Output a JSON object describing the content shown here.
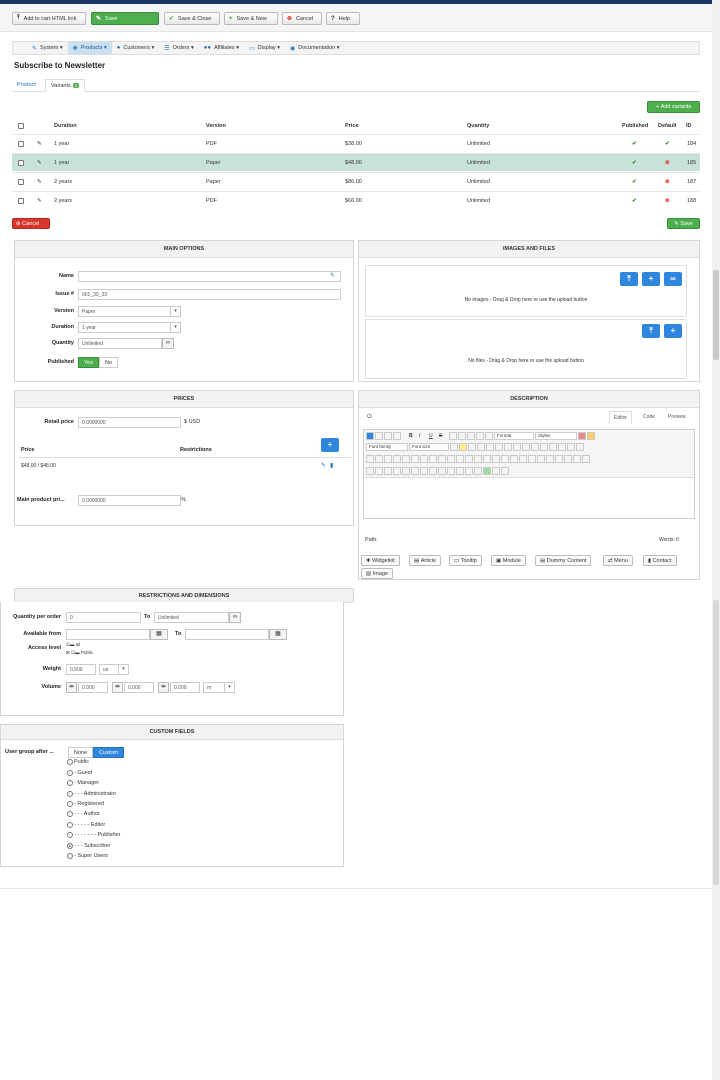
{
  "toolbar": {
    "add_to_cart": "Add to cart HTML link",
    "save": "Save",
    "save_close": "Save & Close",
    "save_new": "Save & New",
    "cancel": "Cancel",
    "help": "Help"
  },
  "menu": {
    "items": [
      "System",
      "Products",
      "Customers",
      "Orders",
      "Affiliates",
      "Display",
      "Documentation"
    ],
    "active": "Products"
  },
  "page_title": "Subscribe to Newsletter",
  "tabs": {
    "product": "Product",
    "variants": "Variants",
    "variants_count": "4"
  },
  "variants": {
    "add_button": "Add variants",
    "headers": {
      "duration": "Duration",
      "version": "Version",
      "price": "Price",
      "quantity": "Quantity",
      "published": "Published",
      "default": "Default",
      "id": "ID"
    },
    "rows": [
      {
        "duration": "1 year",
        "version": "PDF",
        "price": "$38.00",
        "quantity": "Unlimited",
        "published": "yes",
        "default": "yes",
        "id": "184"
      },
      {
        "duration": "1 year",
        "version": "Paper",
        "price": "$48.00",
        "quantity": "Unlimited",
        "published": "yes",
        "default": "no",
        "id": "185"
      },
      {
        "duration": "2 years",
        "version": "Paper",
        "price": "$86.00",
        "quantity": "Unlimited",
        "published": "yes",
        "default": "no",
        "id": "187"
      },
      {
        "duration": "2 years",
        "version": "PDF",
        "price": "$66.00",
        "quantity": "Unlimited",
        "published": "yes",
        "default": "no",
        "id": "188"
      }
    ],
    "cancel": "Cancel",
    "save": "Save"
  },
  "main_options": {
    "title": "MAIN OPTIONS",
    "name_label": "Name",
    "name_value": "",
    "issue_label": "Issue #",
    "issue_value": "001_30_33",
    "version_label": "Version",
    "version_value": "Paper",
    "duration_label": "Duration",
    "duration_value": "1 year",
    "quantity_label": "Quantity",
    "quantity_value": "Unlimited",
    "published_label": "Published",
    "yes": "Yes",
    "no": "No"
  },
  "images_files": {
    "title": "IMAGES AND FILES",
    "no_images": "No images - Drag & Drop here or use the upload button",
    "no_files": "No files - Drag & Drop here or use the upload button"
  },
  "prices": {
    "title": "PRICES",
    "retail_label": "Retail price",
    "retail_value": "0.0000000",
    "currency": "$ USD",
    "col_price": "Price",
    "col_restrictions": "Restrictions",
    "row_price": "$48.00 / $48.00",
    "main_product_label": "Main product pri...",
    "main_product_value": "0.0000000",
    "percent": "%"
  },
  "description": {
    "title": "DESCRIPTION",
    "tab_editor": "Editor",
    "tab_code": "Code",
    "tab_preview": "Preview",
    "format": "Format",
    "styles": "Styles",
    "font_family": "Font family",
    "font_size": "Font size",
    "path": "Path:",
    "words": "Words: 0",
    "buttons": [
      "Widgetkit",
      "Article",
      "Tooltip",
      "Module",
      "Dummy Content",
      "Menu",
      "Contact",
      "Image"
    ]
  },
  "restrictions": {
    "title": "RESTRICTIONS AND DIMENSIONS",
    "qty_label": "Quantity per order",
    "qty_from": "0",
    "to": "To",
    "qty_to": "Unlimited",
    "available_label": "Available from",
    "available_from": "",
    "available_to": "",
    "access_label": "Access level",
    "access_all": "all",
    "access_public": "Public",
    "weight_label": "Weight",
    "weight_value": "0.500",
    "weight_unit": "oz",
    "volume_label": "Volume",
    "vol1": "0.000",
    "vol2": "0.000",
    "vol3": "0.000",
    "vol_unit": "m"
  },
  "custom_fields": {
    "title": "CUSTOM FIELDS",
    "group_label": "User group after ...",
    "none": "None",
    "custom": "Custom",
    "groups": [
      "Public",
      "- Guest",
      "- Manager",
      "- - - Administrator",
      "- Registered",
      "- - - Author",
      "- - - - - Editor",
      "- - - - - - - Publisher",
      "- - - Subscriber",
      "- Super Users"
    ],
    "selected_index": 8
  }
}
